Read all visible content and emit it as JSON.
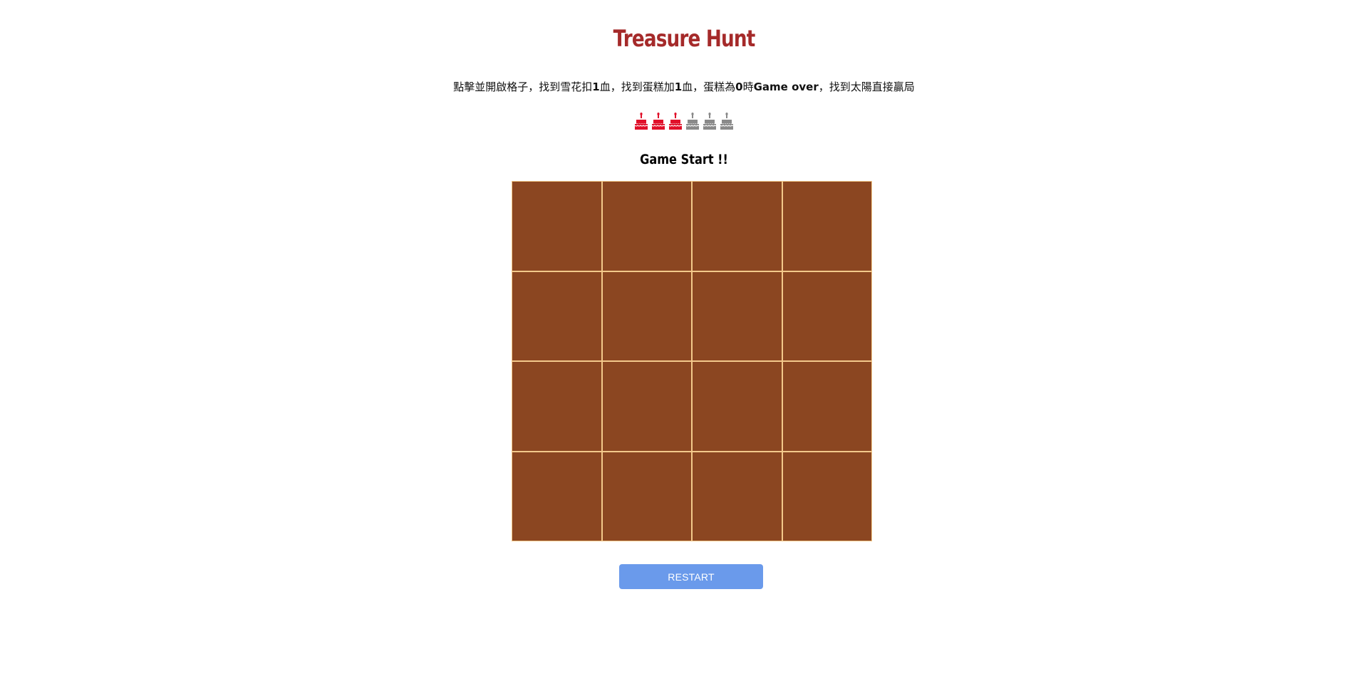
{
  "game": {
    "title": "Treasure Hunt",
    "instructions": {
      "part1": "點擊並開啟格子，找到雪花扣",
      "num1": "1",
      "part2": "血，找到蛋糕加",
      "num2": "1",
      "part3": "血，蛋糕為",
      "num3": "0",
      "part4": "時",
      "game_over": "Game over",
      "part5": "，找到太陽直接贏局"
    },
    "status": "Game Start !!",
    "restart_label": "RESTART"
  },
  "lives": {
    "current": 3,
    "max": 6,
    "icon": "cake-icon",
    "active_color": "#e0102a",
    "inactive_color": "#8a8a8a"
  },
  "board": {
    "rows": 4,
    "cols": 4,
    "cell_color": "#8b4621",
    "grid_color": "#f3c98b"
  },
  "colors": {
    "title": "#a52a2a",
    "button": "#6a9aeb"
  }
}
